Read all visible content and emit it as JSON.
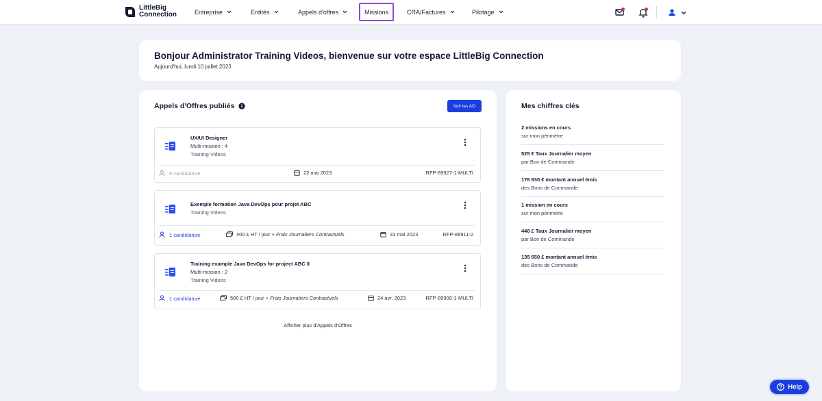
{
  "brand": {
    "line1": "LittleBig",
    "line2": "Connection"
  },
  "nav": {
    "items": [
      {
        "label": "Entreprise",
        "chevron": true
      },
      {
        "label": "Entités",
        "chevron": true
      },
      {
        "label": "Appels d'offres",
        "chevron": true
      },
      {
        "label": "Missions",
        "chevron": false,
        "active": true
      },
      {
        "label": "CRA/Factures",
        "chevron": true
      },
      {
        "label": "Pilotage",
        "chevron": true
      }
    ],
    "right_icons": [
      "mail-icon",
      "bell-icon",
      "user-icon"
    ]
  },
  "welcome": {
    "title": "Bonjour Administrator Training Videos, bienvenue sur votre espace LittleBig Connection",
    "date": "Aujourd'hui, lundi 10 juillet 2023"
  },
  "offers_panel": {
    "title": "Appels d'Offres publiés",
    "voir_label": "Voir les AO",
    "more_label": "Afficher plus d'Appels d'Offres",
    "offers": [
      {
        "title": "UX/UI Designer",
        "multi": "Multi-mission : 4",
        "client": "Training Videos",
        "candidatures": "0 candidature",
        "rate": "",
        "rate_note": "",
        "date": "22 mai 2023",
        "ref": "RFP-89927-1-MULTI"
      },
      {
        "title": "Exemple formation Java DevOps pour projet ABC",
        "multi": "",
        "client": "Training Videos",
        "candidatures": "1 candidature",
        "rate": "400 £ HT / jour",
        "rate_note": "+ Frais Journaliers Contractuels",
        "date": "31 mai 2023",
        "ref": "RFP-89911-2"
      },
      {
        "title": "Training example Java DevOps for project ABC II",
        "multi": "Multi-mission : 2",
        "client": "Training Videos",
        "candidatures": "1 candidature",
        "rate": "500 £ HT / jour",
        "rate_note": "+ Frais Journaliers Contractuels",
        "date": "24 avr. 2023",
        "ref": "RFP-89900-1-MULTI"
      }
    ]
  },
  "kpis": {
    "title": "Mes chiffres clés",
    "items": [
      {
        "value": "2 missions en cours",
        "label": "sur mon périmètre"
      },
      {
        "value": "525 € Taux Journalier moyen",
        "label": "par Bon de Commande"
      },
      {
        "value": "176 830 € montant annuel émis",
        "label": "des Bons de Commande"
      },
      {
        "value": "1 mission en cours",
        "label": "sur mon périmètre"
      },
      {
        "value": "448 £ Taux Journalier moyen",
        "label": "par Bon de Commande"
      },
      {
        "value": "135 650 £ montant annuel émis",
        "label": "des Bons de Commande"
      }
    ]
  },
  "help": {
    "label": "Help"
  },
  "colors": {
    "accent": "#1c3ee0",
    "active_outline": "#8a4bd9",
    "badge": "#e0245e",
    "background": "#eef1f6"
  }
}
